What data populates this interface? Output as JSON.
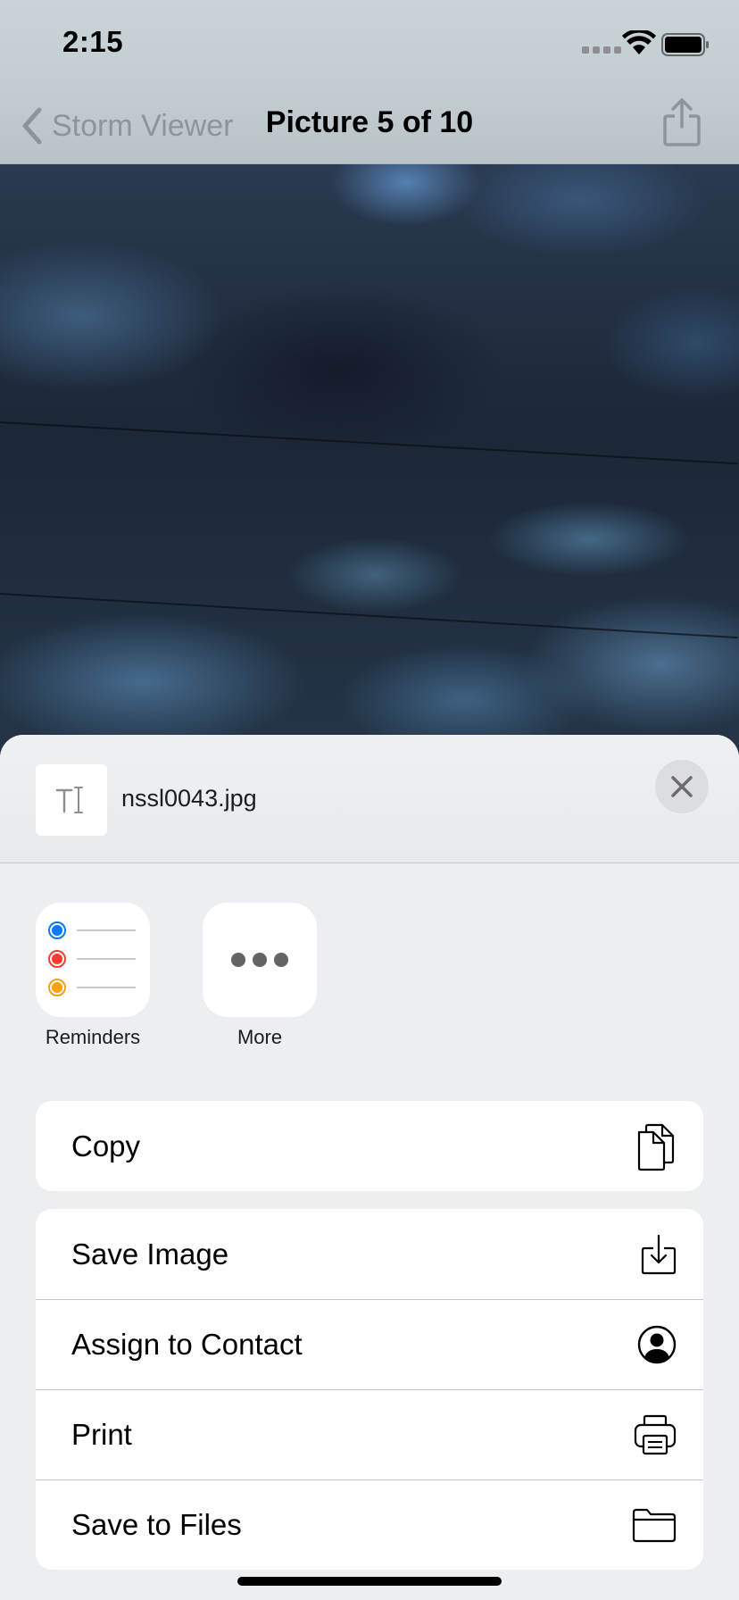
{
  "status_bar": {
    "time": "2:15"
  },
  "nav": {
    "back_label": "Storm Viewer",
    "title": "Picture 5 of 10"
  },
  "share_sheet": {
    "file_name": "nssl0043.jpg",
    "apps": [
      {
        "label": "Reminders",
        "icon": "reminders-icon"
      },
      {
        "label": "More",
        "icon": "more-icon"
      }
    ],
    "actions_primary": [
      {
        "label": "Copy",
        "icon": "copy-icon"
      }
    ],
    "actions_secondary": [
      {
        "label": "Save Image",
        "icon": "save-image-icon"
      },
      {
        "label": "Assign to Contact",
        "icon": "contact-icon"
      },
      {
        "label": "Print",
        "icon": "print-icon"
      },
      {
        "label": "Save to Files",
        "icon": "folder-icon"
      }
    ]
  },
  "colors": {
    "reminder_blue": "#0a7aff",
    "reminder_red": "#ff3b30",
    "reminder_orange": "#ff9f0a",
    "sheet_background": "#eceef1"
  }
}
